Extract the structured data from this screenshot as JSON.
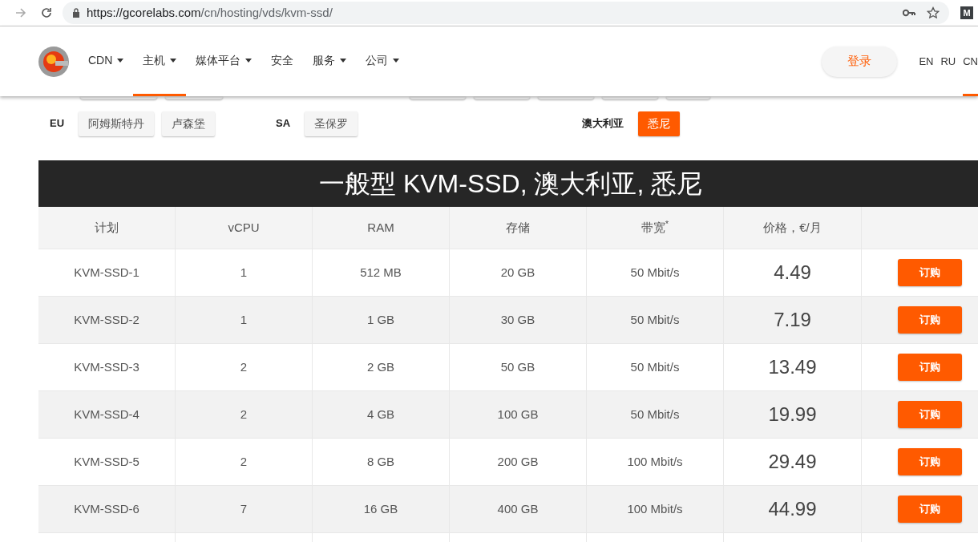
{
  "browser": {
    "url_host": "https://gcorelabs.com",
    "url_path": "/cn/hosting/vds/kvm-ssd/",
    "extension_label": "M"
  },
  "nav": {
    "items": [
      {
        "label": "CDN",
        "dropdown": true,
        "selected": false
      },
      {
        "label": "主机",
        "dropdown": true,
        "selected": true
      },
      {
        "label": "媒体平台",
        "dropdown": true,
        "selected": false
      },
      {
        "label": "安全",
        "dropdown": false,
        "selected": false
      },
      {
        "label": "服务",
        "dropdown": true,
        "selected": false
      },
      {
        "label": "公司",
        "dropdown": true,
        "selected": false
      }
    ],
    "login": "登录",
    "languages": [
      {
        "label": "EN",
        "selected": false
      },
      {
        "label": "RU",
        "selected": false
      },
      {
        "label": "CN",
        "selected": true
      }
    ]
  },
  "regions": [
    {
      "name": "EU",
      "locations": [
        {
          "label": "阿姆斯特丹",
          "selected": false
        },
        {
          "label": "卢森堡",
          "selected": false
        }
      ]
    },
    {
      "name": "SA",
      "locations": [
        {
          "label": "圣保罗",
          "selected": false
        }
      ]
    },
    {
      "name": "澳大利亚",
      "locations": [
        {
          "label": "悉尼",
          "selected": true
        }
      ]
    }
  ],
  "table": {
    "title": "一般型 KVM-SSD, 澳大利亚, 悉尼",
    "columns": [
      "计划",
      "vCPU",
      "RAM",
      "存储",
      "带宽$^{*}$",
      "价格，€/月"
    ],
    "rows": [
      {
        "plan": "KVM-SSD-1",
        "vcpu": "1",
        "ram": "512 MB",
        "storage": "20 GB",
        "bandwidth": "50 Mbit/s",
        "price": "4.49",
        "action": "订购"
      },
      {
        "plan": "KVM-SSD-2",
        "vcpu": "1",
        "ram": "1 GB",
        "storage": "30 GB",
        "bandwidth": "50 Mbit/s",
        "price": "7.19",
        "action": "订购"
      },
      {
        "plan": "KVM-SSD-3",
        "vcpu": "2",
        "ram": "2 GB",
        "storage": "50 GB",
        "bandwidth": "50 Mbit/s",
        "price": "13.49",
        "action": "订购"
      },
      {
        "plan": "KVM-SSD-4",
        "vcpu": "2",
        "ram": "4 GB",
        "storage": "100 GB",
        "bandwidth": "50 Mbit/s",
        "price": "19.99",
        "action": "订购"
      },
      {
        "plan": "KVM-SSD-5",
        "vcpu": "2",
        "ram": "8 GB",
        "storage": "200 GB",
        "bandwidth": "100 Mbit/s",
        "price": "29.49",
        "action": "订购"
      },
      {
        "plan": "KVM-SSD-6",
        "vcpu": "7",
        "ram": "16 GB",
        "storage": "400 GB",
        "bandwidth": "100 Mbit/s",
        "price": "44.99",
        "action": "订购"
      }
    ]
  }
}
